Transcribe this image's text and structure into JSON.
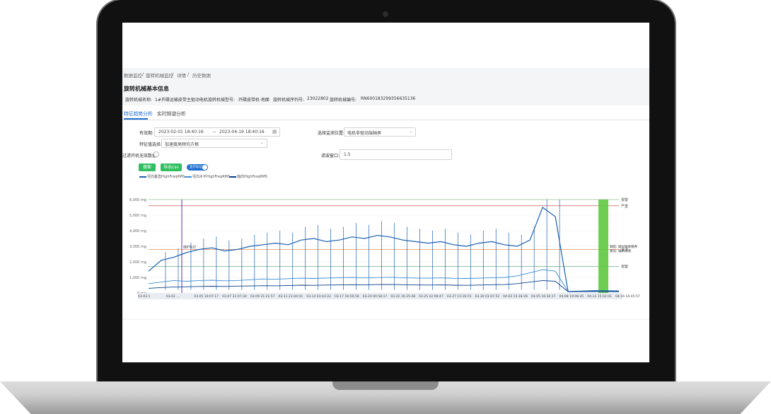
{
  "breadcrumb": [
    "数据监控",
    "旋转机械监控",
    "详情",
    "历史数据"
  ],
  "page_title": "旋转机械基本信息",
  "info": [
    {
      "label": "旋转机械名称:",
      "value": "1#开磷运输皮带主驱动电机"
    },
    {
      "label": "旋转机械型号:",
      "value": "开磷皮带机·地面"
    },
    {
      "label": "旋转机械序列号:",
      "value": "23022802"
    },
    {
      "label": "旋转机械编号:",
      "value": "RN600183299356635136"
    }
  ],
  "tabs": [
    {
      "label": "特征趋势分析",
      "active": true
    },
    {
      "label": "实时频谱分析",
      "active": false
    }
  ],
  "form": {
    "date_label": "有效期:",
    "date_start": "2023-02-01 18:40:16",
    "date_sep": "→",
    "date_end": "2023-04-19 18:40:16",
    "position_label": "选择监测位置:",
    "position_value": "电机非驱动端轴承",
    "feature_label": "特征值选择:",
    "feature_value": "加速度高频均方根",
    "filter_label": "过滤开机无效数据:",
    "window_label": "滤波窗口:",
    "window_value": "1.5",
    "search_btn": "搜索",
    "export_btn": "导出csv",
    "toggle_label": "显示标记"
  },
  "colors": {
    "accent": "#1f6fd1",
    "button": "#2fbf5e",
    "alarm_band": "#5ec93f",
    "series1": "#1a5fb4",
    "series2": "#3a8fd8",
    "series3": "#0b3f8a"
  },
  "chart_data": {
    "type": "line",
    "series": [
      {
        "name": "径向垂直HighFreqRMS",
        "values": [
          1400,
          2100,
          2300,
          2600,
          2800,
          2900,
          2700,
          2800,
          3000,
          3100,
          3200,
          3100,
          3400,
          3500,
          3300,
          3400,
          3600,
          3500,
          3700,
          3600,
          3400,
          3300,
          3200,
          3300,
          3100,
          3000,
          3200,
          3300,
          3100,
          3000,
          3400,
          5500,
          4900,
          100,
          120,
          150,
          140,
          130
        ]
      },
      {
        "name": "径向水平HighFreqRMS",
        "values": [
          600,
          700,
          800,
          750,
          800,
          820,
          780,
          800,
          850,
          900,
          880,
          920,
          950,
          930,
          960,
          980,
          1000,
          970,
          990,
          1010,
          980,
          960,
          950,
          970,
          940,
          930,
          950,
          980,
          1000,
          1100,
          1300,
          1500,
          1400,
          90,
          100,
          110,
          100,
          95
        ]
      },
      {
        "name": "轴向HighFreqRMS",
        "values": [
          300,
          350,
          380,
          400,
          420,
          430,
          420,
          440,
          450,
          470,
          460,
          480,
          500,
          490,
          510,
          520,
          530,
          520,
          540,
          550,
          530,
          520,
          510,
          520,
          500,
          490,
          510,
          530,
          540,
          600,
          700,
          800,
          750,
          80,
          85,
          90,
          85,
          80
        ]
      }
    ],
    "ylim": [
      0,
      6000
    ],
    "y_ticks": [
      "0 mg",
      "1,000 mg",
      "2,000 mg",
      "3,000 mg",
      "4,000 mg",
      "5,000 mg",
      "6,000 mg"
    ],
    "x_ticks": [
      "03-03 1",
      "03-02 ...",
      "03-05 19:07:17",
      "03-07 21:07:34",
      "03-09 21:21:57",
      "03-11 21:04:41",
      "03-14 03:43:22",
      "03-17 16:56:58",
      "03-20 00:58:17",
      "03-22 16:35:48",
      "03-25 02:09:47",
      "03-27 15:16:55",
      "03-30 01:07:52",
      "04-02 15:18:28",
      "04-05 16:30:17",
      "04-08 19:06:45",
      "04-11 15:02:01",
      "04-16 16:45:57"
    ],
    "thresholds": [
      {
        "label": "报警",
        "value": 6000
      },
      {
        "label": "严重",
        "value": 5600
      },
      {
        "label": "关注",
        "value": 2800
      },
      {
        "label": "预警",
        "value": 1700
      }
    ],
    "annotation": {
      "lines": [
        "缺陷: 疑似轴承保养",
        "建议: 轴承润滑"
      ]
    },
    "marker_text": "维护标记",
    "grid": true,
    "legend_position": "top-left"
  }
}
